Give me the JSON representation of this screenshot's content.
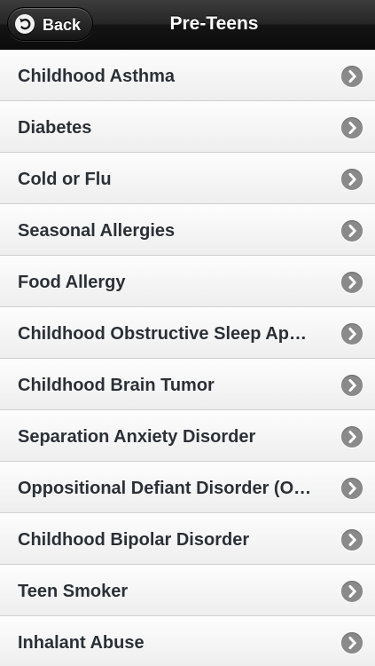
{
  "navbar": {
    "title": "Pre-Teens",
    "back_label": "Back",
    "back_icon": "undo-arrow-icon"
  },
  "list": {
    "items": [
      {
        "label": "Childhood Asthma"
      },
      {
        "label": "Diabetes"
      },
      {
        "label": "Cold or Flu"
      },
      {
        "label": "Seasonal Allergies"
      },
      {
        "label": "Food Allergy"
      },
      {
        "label": "Childhood Obstructive Sleep Ap…"
      },
      {
        "label": "Childhood Brain Tumor"
      },
      {
        "label": "Separation Anxiety Disorder"
      },
      {
        "label": "Oppositional Defiant Disorder (O…"
      },
      {
        "label": "Childhood Bipolar Disorder"
      },
      {
        "label": "Teen Smoker"
      },
      {
        "label": "Inhalant Abuse"
      }
    ],
    "item_icon": "chevron-right-icon"
  },
  "colors": {
    "navbar_background": "#141414",
    "nav_text": "#ffffff",
    "list_background": "#f4f4f4",
    "item_text": "#2b3036",
    "chevron_circle": "#8a8a8a"
  }
}
